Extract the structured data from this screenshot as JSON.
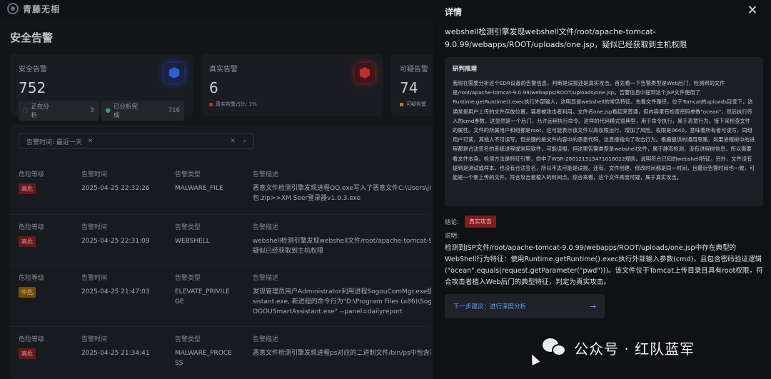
{
  "app": {
    "logo_text": "青藤无相",
    "page_title": "安全告警"
  },
  "cards": {
    "security": {
      "label": "安全告警",
      "value": "752",
      "analyzing_label": "正在分析",
      "analyzing_count": "3",
      "done_label": "已分析完成",
      "done_count": "716",
      "accent": "#3b6df5"
    },
    "real": {
      "label": "真实告警",
      "value": "6",
      "ratio": "真实告警占比: 1%",
      "accent": "#e0353a"
    },
    "suspicious": {
      "label": "可疑告警",
      "value": "74",
      "ratio": "可疑告警"
    }
  },
  "table": {
    "filter_label": "告警时间: 最近一天",
    "columns": [
      "危险等级",
      "告警时间",
      "告警类型",
      "告警描述"
    ],
    "rows": [
      {
        "level": "高危",
        "time": "2025-04-25 22:32:26",
        "type": "MALWARE_FILE",
        "desc1": "恶意文件检测引擎发现进程QQ.exe写入了恶意文件C:\\Users\\jice",
        "desc2": "包.zip>>XM Seer登录器v1.0.3.exe"
      },
      {
        "level": "高危",
        "time": "2025-04-25 22:31:09",
        "type": "WEBSHELL",
        "desc1": "webshell检测引擎发现webshell文件/root/apache-tomcat-9.0.9",
        "desc2": "疑似已经获取到主机权限"
      },
      {
        "level": "中危",
        "time": "2025-04-25 21:47:03",
        "type": "ELEVATE_PRIVILE",
        "type2": "GE",
        "desc1": "发现管理员用户Administrator利用进程SogouComMgr.exe提权到",
        "desc2": "sistant.exe, 新进程的命令行为\"D:\\Program Files (x86)\\Sogoul",
        "desc3": "OGOUSmartAssistant.exe\" --panel=dailyreport"
      },
      {
        "level": "高危",
        "time": "2025-04-25 21:34:41",
        "type": "MALWARE_PROCE",
        "type2": "SS",
        "desc1": "恶意文件检测引擎发现进程ps对应的二进制文件/bin/ps中包含恶意"
      }
    ]
  },
  "drawer": {
    "title": "详情",
    "headline": "webshell检测引擎发现webshell文件/root/apache-tomcat-9.0.99/webapps/ROOT/uploads/one.jsp，疑似已经获取到主机权限",
    "reason_title": "研判推理",
    "reason_text": "我现在需要分析这个EDR设备的告警信息，判断是误报还是真实攻击。首先看一下告警类型是Web后门，检测到的文件是/root/apache-tomcat-9.0.99/webapps/ROOT/uploads/one.jsp。告警信息中提到这个JSP文件使用了Runtime.getRuntime().exec执行外部输入，这明显是webshell的常见特征。先看文件路径，位于Tomcat的uploads目录下，这通常是用户上传的文件存放位置，容易被攻击者利用。文件名one.jsp看起来普通，但内容里有检查密码参数\"ocean\"，然后执行传入的cmd参数，这显然是一个后门，允许远程执行命令。这样的代码模式很典型，用于命令执行，属于恶意行为。接下来检查文件的属性。文件的所属用户和组都是root，这可能表示该文件以高权限运行，增加了风险。权限是0640，意味着所有者可读写，同组用户可读，其他人不可读写。但关键的是文件内容中的恶意代码，这直接指向了攻击行为。根据提供的通用思路，如果进程树中的进程都是合法签名的系统进程或常用软件，可能误报。但这里告警类型是webshell文件，属于静态检测，没有进程树信息，所以需要看文件本身。检测方法是特征引擎，命中了WSR-2001215154710160​22规则，说明符合已知的webshell特征。另外，文件没有提到是测试或样本，也没有合法签名，所以不太可能是误报。还有，文件创建、修改时间都是同一时间，且最近告警时间也一致，可能是一个新上传的文件，符合攻击者植入的时间点。综合来看，这个文件高度可疑，属于真实攻击。",
    "conclusion_label": "结论:",
    "conclusion_badge": "真实攻击",
    "explain_label": "说明:",
    "explain_text": "检测到JSP文件/root/apache-tomcat-9.0.99/webapps/ROOT/uploads/one.jsp中存在典型的WebShell行为特征：使用Runtime.getRuntime().exec执行外部输入参数(cmd)，且包含密码验证逻辑(\"ocean\".equals(request.getParameter(\"pwd\")))。该文件位于Tomcat上传目录且具有root权限，符合攻击者植入Web后门的典型特征，判定为真实攻击。",
    "next_step": "下一步建议：进行深度分析",
    "next_arrow": "→"
  },
  "watermark": {
    "text": "公众号 · 红队蓝军"
  }
}
